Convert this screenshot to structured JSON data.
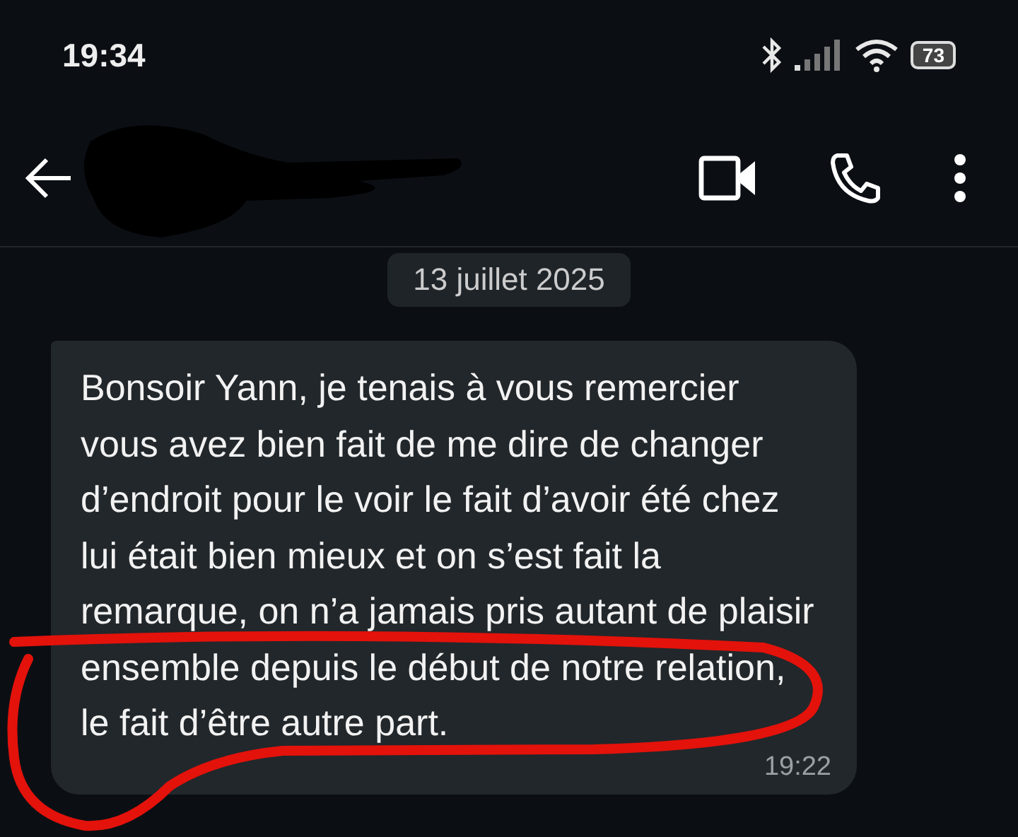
{
  "status_bar": {
    "time": "19:34",
    "battery": "73"
  },
  "header": {
    "title_redacted": true
  },
  "date_chip": "13 juillet 2025",
  "messages": [
    {
      "text": "Bonsoir Yann, je tenais à vous remercier vous avez bien fait de me dire de changer d’endroit pour le voir le fait d’avoir été chez lui était bien mieux et on s’est fait la remarque, on n’a jamais pris autant de plaisir ensemble depuis le début de notre relation, le fait d’être autre part.",
      "time": "19:22",
      "annotated": true
    }
  ]
}
